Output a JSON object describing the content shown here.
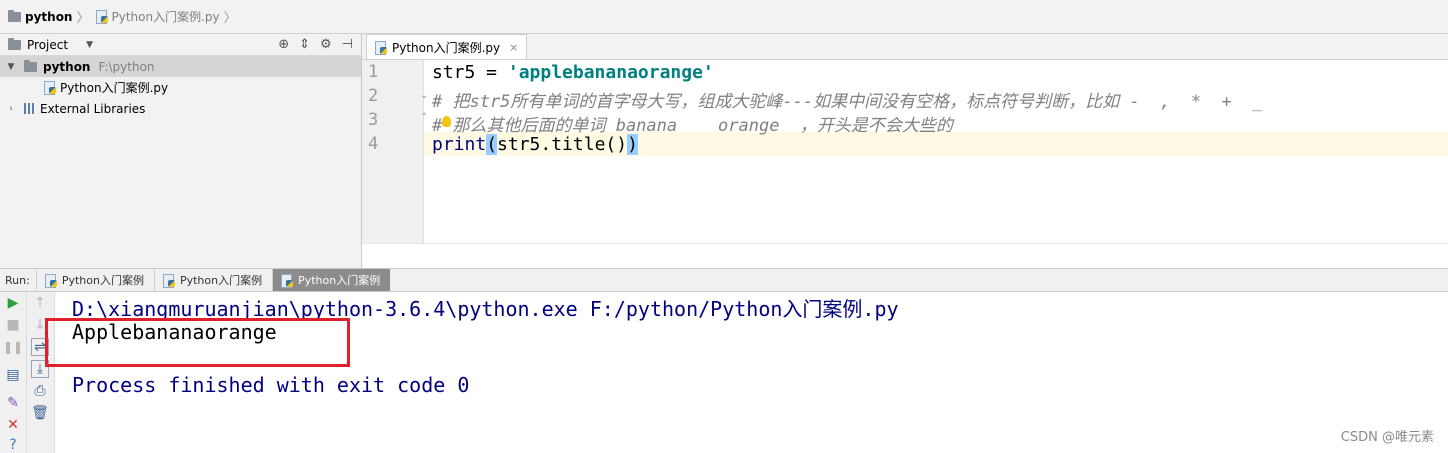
{
  "breadcrumb": {
    "project": "python",
    "file": "Python入门案例.py"
  },
  "project_panel": {
    "label": "Project",
    "root_name": "python",
    "root_path": "F:\\python",
    "file_name": "Python入门案例.py",
    "libraries": "External Libraries"
  },
  "editor": {
    "tab_label": "Python入门案例.py",
    "line_numbers": [
      "1",
      "2",
      "3",
      "4"
    ],
    "line1_var": "str5 = ",
    "line1_str": "'applebananaorange'",
    "line2": "# 把str5所有单词的首字母大写，组成大驼峰---如果中间没有空格，标点符号判断，比如 -  ,  *  +  _",
    "line3": "# 那么其他后面的单词 banana    orange  ，开头是不会大些的",
    "line4_fn": "print",
    "line4_open": "(",
    "line4_mid": "str5.title()",
    "line4_close": ")"
  },
  "run": {
    "label": "Run:",
    "tabs": [
      "Python入门案例",
      "Python入门案例",
      "Python入门案例"
    ],
    "command": "D:\\xiangmuruanjian\\python-3.6.4\\python.exe F:/python/Python入门案例.py",
    "output": "Applebananaorange",
    "exit": "Process finished with exit code 0"
  },
  "watermark": "CSDN @唯元素",
  "colors": {
    "string": "#008080",
    "comment": "#808080",
    "console_blue": "#000080",
    "highlight_box": "#e0202a"
  }
}
